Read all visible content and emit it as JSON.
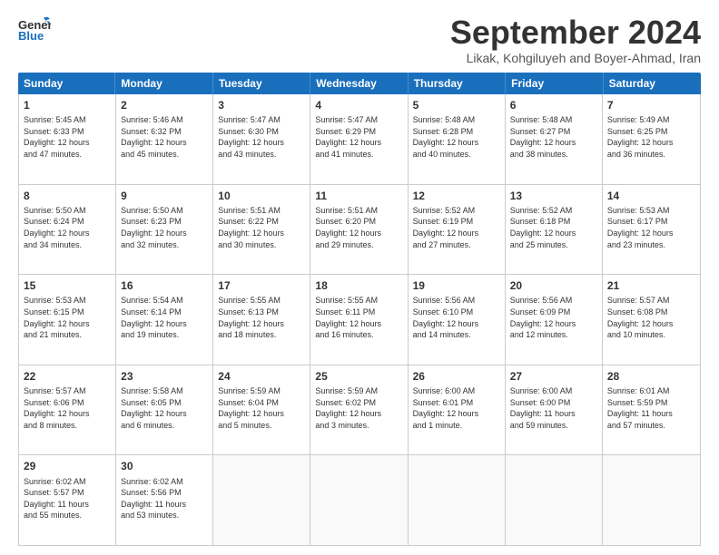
{
  "header": {
    "logo_line1": "General",
    "logo_line2": "Blue",
    "month": "September 2024",
    "location": "Likak, Kohgiluyeh and Boyer-Ahmad, Iran"
  },
  "weekdays": [
    "Sunday",
    "Monday",
    "Tuesday",
    "Wednesday",
    "Thursday",
    "Friday",
    "Saturday"
  ],
  "weeks": [
    [
      {
        "day": "1",
        "text": "Sunrise: 5:45 AM\nSunset: 6:33 PM\nDaylight: 12 hours\nand 47 minutes."
      },
      {
        "day": "2",
        "text": "Sunrise: 5:46 AM\nSunset: 6:32 PM\nDaylight: 12 hours\nand 45 minutes."
      },
      {
        "day": "3",
        "text": "Sunrise: 5:47 AM\nSunset: 6:30 PM\nDaylight: 12 hours\nand 43 minutes."
      },
      {
        "day": "4",
        "text": "Sunrise: 5:47 AM\nSunset: 6:29 PM\nDaylight: 12 hours\nand 41 minutes."
      },
      {
        "day": "5",
        "text": "Sunrise: 5:48 AM\nSunset: 6:28 PM\nDaylight: 12 hours\nand 40 minutes."
      },
      {
        "day": "6",
        "text": "Sunrise: 5:48 AM\nSunset: 6:27 PM\nDaylight: 12 hours\nand 38 minutes."
      },
      {
        "day": "7",
        "text": "Sunrise: 5:49 AM\nSunset: 6:25 PM\nDaylight: 12 hours\nand 36 minutes."
      }
    ],
    [
      {
        "day": "8",
        "text": "Sunrise: 5:50 AM\nSunset: 6:24 PM\nDaylight: 12 hours\nand 34 minutes."
      },
      {
        "day": "9",
        "text": "Sunrise: 5:50 AM\nSunset: 6:23 PM\nDaylight: 12 hours\nand 32 minutes."
      },
      {
        "day": "10",
        "text": "Sunrise: 5:51 AM\nSunset: 6:22 PM\nDaylight: 12 hours\nand 30 minutes."
      },
      {
        "day": "11",
        "text": "Sunrise: 5:51 AM\nSunset: 6:20 PM\nDaylight: 12 hours\nand 29 minutes."
      },
      {
        "day": "12",
        "text": "Sunrise: 5:52 AM\nSunset: 6:19 PM\nDaylight: 12 hours\nand 27 minutes."
      },
      {
        "day": "13",
        "text": "Sunrise: 5:52 AM\nSunset: 6:18 PM\nDaylight: 12 hours\nand 25 minutes."
      },
      {
        "day": "14",
        "text": "Sunrise: 5:53 AM\nSunset: 6:17 PM\nDaylight: 12 hours\nand 23 minutes."
      }
    ],
    [
      {
        "day": "15",
        "text": "Sunrise: 5:53 AM\nSunset: 6:15 PM\nDaylight: 12 hours\nand 21 minutes."
      },
      {
        "day": "16",
        "text": "Sunrise: 5:54 AM\nSunset: 6:14 PM\nDaylight: 12 hours\nand 19 minutes."
      },
      {
        "day": "17",
        "text": "Sunrise: 5:55 AM\nSunset: 6:13 PM\nDaylight: 12 hours\nand 18 minutes."
      },
      {
        "day": "18",
        "text": "Sunrise: 5:55 AM\nSunset: 6:11 PM\nDaylight: 12 hours\nand 16 minutes."
      },
      {
        "day": "19",
        "text": "Sunrise: 5:56 AM\nSunset: 6:10 PM\nDaylight: 12 hours\nand 14 minutes."
      },
      {
        "day": "20",
        "text": "Sunrise: 5:56 AM\nSunset: 6:09 PM\nDaylight: 12 hours\nand 12 minutes."
      },
      {
        "day": "21",
        "text": "Sunrise: 5:57 AM\nSunset: 6:08 PM\nDaylight: 12 hours\nand 10 minutes."
      }
    ],
    [
      {
        "day": "22",
        "text": "Sunrise: 5:57 AM\nSunset: 6:06 PM\nDaylight: 12 hours\nand 8 minutes."
      },
      {
        "day": "23",
        "text": "Sunrise: 5:58 AM\nSunset: 6:05 PM\nDaylight: 12 hours\nand 6 minutes."
      },
      {
        "day": "24",
        "text": "Sunrise: 5:59 AM\nSunset: 6:04 PM\nDaylight: 12 hours\nand 5 minutes."
      },
      {
        "day": "25",
        "text": "Sunrise: 5:59 AM\nSunset: 6:02 PM\nDaylight: 12 hours\nand 3 minutes."
      },
      {
        "day": "26",
        "text": "Sunrise: 6:00 AM\nSunset: 6:01 PM\nDaylight: 12 hours\nand 1 minute."
      },
      {
        "day": "27",
        "text": "Sunrise: 6:00 AM\nSunset: 6:00 PM\nDaylight: 11 hours\nand 59 minutes."
      },
      {
        "day": "28",
        "text": "Sunrise: 6:01 AM\nSunset: 5:59 PM\nDaylight: 11 hours\nand 57 minutes."
      }
    ],
    [
      {
        "day": "29",
        "text": "Sunrise: 6:02 AM\nSunset: 5:57 PM\nDaylight: 11 hours\nand 55 minutes."
      },
      {
        "day": "30",
        "text": "Sunrise: 6:02 AM\nSunset: 5:56 PM\nDaylight: 11 hours\nand 53 minutes."
      },
      {
        "day": "",
        "text": ""
      },
      {
        "day": "",
        "text": ""
      },
      {
        "day": "",
        "text": ""
      },
      {
        "day": "",
        "text": ""
      },
      {
        "day": "",
        "text": ""
      }
    ]
  ]
}
